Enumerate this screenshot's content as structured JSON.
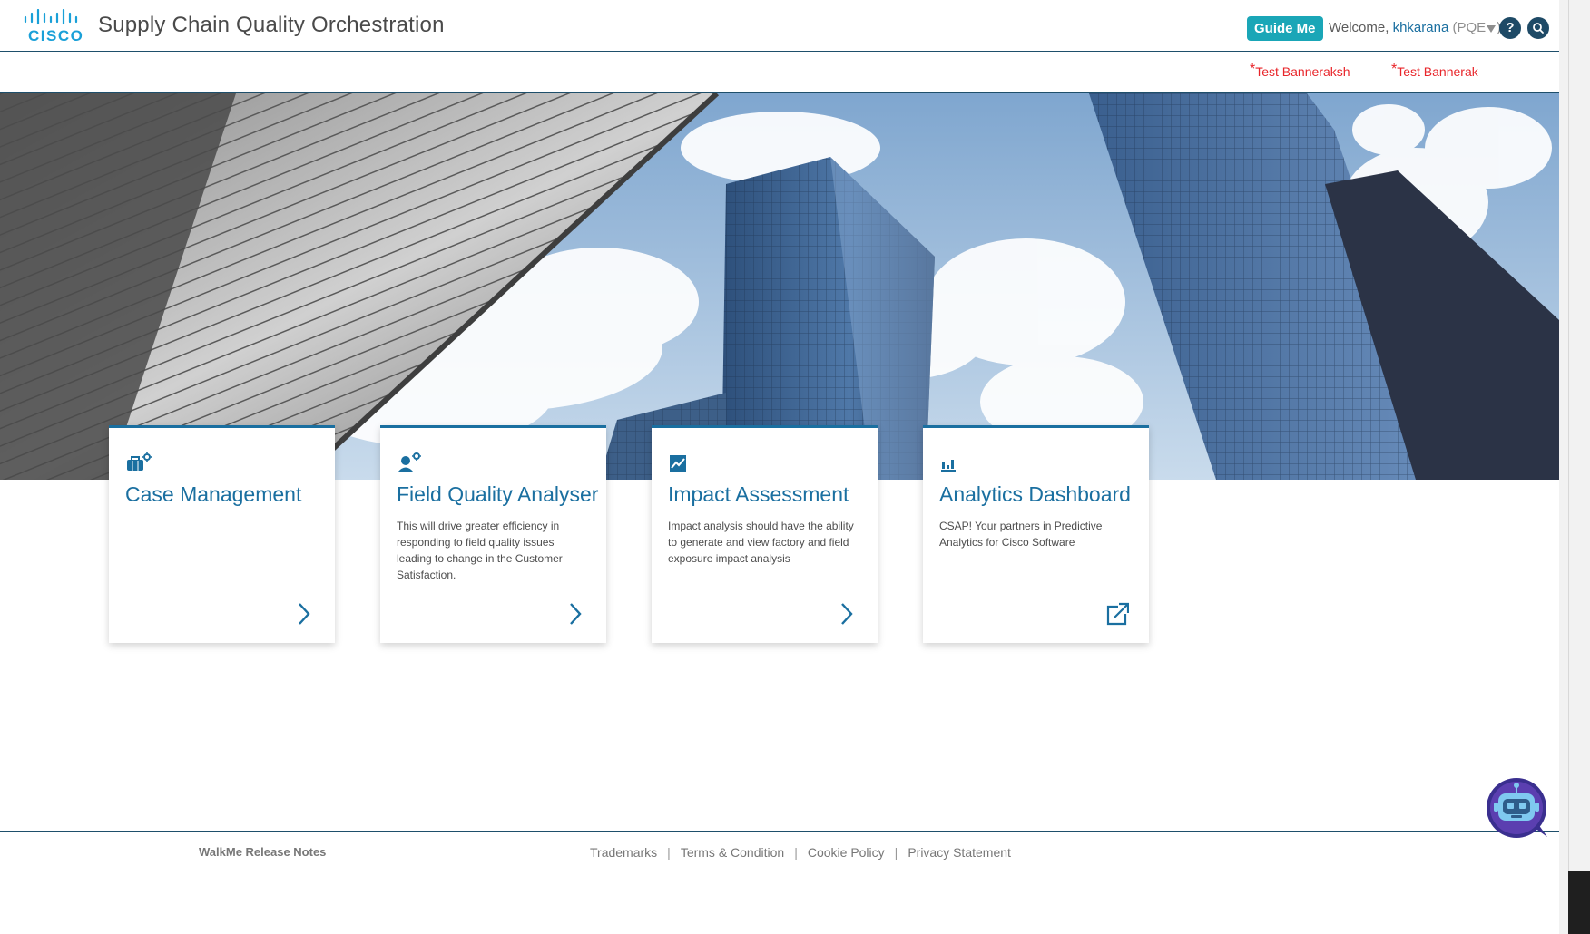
{
  "header": {
    "logo_text": "CISCO",
    "app_title": "Supply Chain Quality Orchestration",
    "guide_label": "Guide Me",
    "welcome_prefix": "Welcome,",
    "username": "khkarana",
    "role_open": "(PQE",
    "role_close": ")",
    "help_glyph": "?",
    "search_icon": "search-icon"
  },
  "banners": [
    {
      "star": "*",
      "label": "Test Banneraksh"
    },
    {
      "star": "*",
      "label": "Test Bannerak"
    }
  ],
  "cards": [
    {
      "icon": "briefcase-gear-icon",
      "title": "Case Management",
      "description": "",
      "action": "chevron-right-icon"
    },
    {
      "icon": "user-gear-icon",
      "title": "Field Quality Analyser",
      "description": "This will drive greater efficiency in responding to field quality issues leading to change in the Customer Satisfaction.",
      "action": "chevron-right-icon"
    },
    {
      "icon": "trend-chart-icon",
      "title": "Impact Assessment",
      "description": "Impact analysis should have the ability to generate and view factory and field exposure impact analysis",
      "action": "chevron-right-icon"
    },
    {
      "icon": "bar-chart-icon",
      "title": "Analytics Dashboard",
      "description": "CSAP! Your partners in Predictive Analytics for Cisco Software",
      "action": "external-link-icon"
    }
  ],
  "footer": {
    "walkme_label": "WalkMe Release Notes",
    "links": [
      "Trademarks",
      "Terms & Condition",
      "Cookie Policy",
      "Privacy Statement"
    ],
    "separator": "|"
  },
  "colors": {
    "accent": "#1a6fa0",
    "header_border": "#1e4f6b",
    "guide_button": "#1aa6b7",
    "banner_text": "#e8252a"
  }
}
